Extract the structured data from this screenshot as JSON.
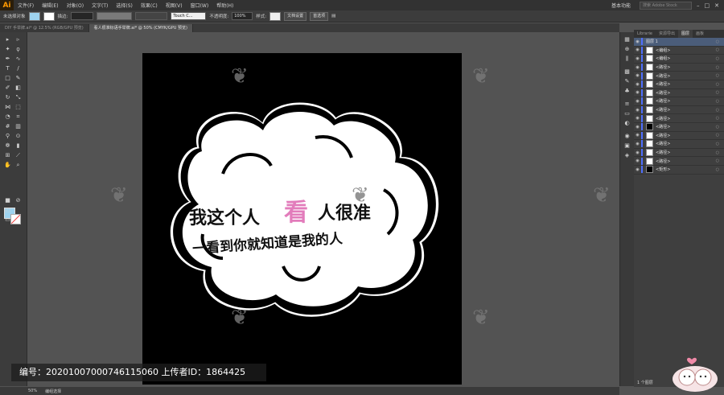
{
  "app": {
    "logo": "Ai"
  },
  "menu": [
    "文件(F)",
    "编辑(E)",
    "对象(O)",
    "文字(T)",
    "选择(S)",
    "效果(C)",
    "视图(V)",
    "窗口(W)",
    "帮助(H)"
  ],
  "workspace": {
    "name": "基本功能",
    "search_placeholder": "搜索 Adobe Stock"
  },
  "control": {
    "selection_label": "未选择对象",
    "stroke_label": "描边:",
    "brush": "Touch C...",
    "opacity_label": "不透明度:",
    "opacity_value": "100%",
    "style_label": "样式:",
    "doc_setup": "文档设置",
    "preferences": "首选项"
  },
  "tabs": [
    {
      "label": "DIY 手举牌.ai* @ 12.5% (RGB/GPU 预览)",
      "active": false
    },
    {
      "label": "看人很准标语手举牌.ai* @ 50% (CMYK/GPU 预览)",
      "active": true
    }
  ],
  "artwork": {
    "line1": "我这个人",
    "highlight": "看",
    "line1_end": "人很准",
    "line2": "一看到你就知道是我的人",
    "highlight_color": "#e27cbb"
  },
  "panel_tabs": [
    "Librarie",
    "资源导出",
    "图层",
    "画板"
  ],
  "layers": {
    "top_layer": "图层 1",
    "rows": [
      {
        "name": "<编组>",
        "dark": false
      },
      {
        "name": "<编组>",
        "dark": false
      },
      {
        "name": "<路径>",
        "dark": false
      },
      {
        "name": "<路径>",
        "dark": false
      },
      {
        "name": "<路径>",
        "dark": false
      },
      {
        "name": "<路径>",
        "dark": false
      },
      {
        "name": "<路径>",
        "dark": false
      },
      {
        "name": "<路径>",
        "dark": false
      },
      {
        "name": "<路径>",
        "dark": false
      },
      {
        "name": "<路径>",
        "dark": true
      },
      {
        "name": "<路径>",
        "dark": false
      },
      {
        "name": "<路径>",
        "dark": false
      },
      {
        "name": "<路径>",
        "dark": false
      },
      {
        "name": "<路径>",
        "dark": false
      },
      {
        "name": "<矩形>",
        "dark": true
      }
    ],
    "count": "1 个图层"
  },
  "status": {
    "zoom": "50%",
    "tool": "编组选择"
  },
  "credit": "编号：20201007000746115060 上传者ID：1864425"
}
